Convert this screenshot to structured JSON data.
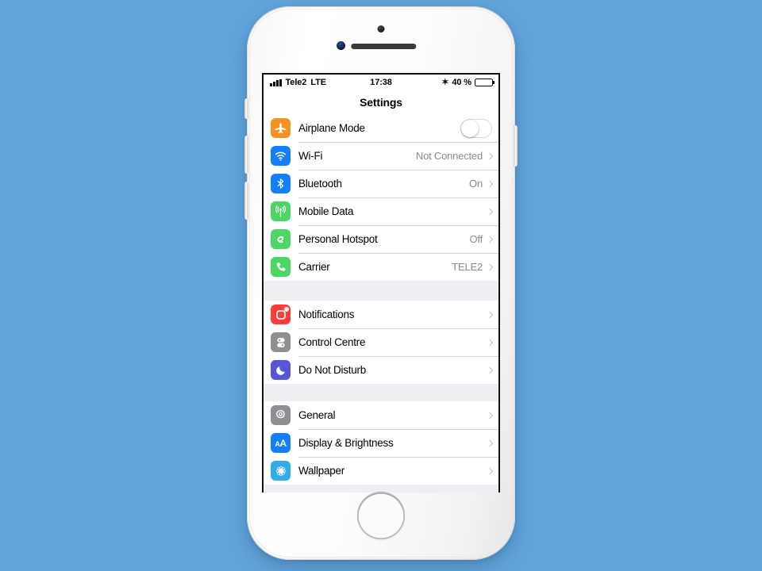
{
  "device": {
    "name": "iphone-white-silver",
    "background_color": "#62a5dc",
    "body_color": "#ffffff"
  },
  "status_bar": {
    "carrier": "Tele2",
    "network_type": "LTE",
    "time": "17:38",
    "bluetooth_icon": "✶",
    "battery_percent": "40 %",
    "battery_level": 40,
    "signal_bars": 4
  },
  "nav": {
    "title": "Settings"
  },
  "groups": [
    {
      "id": "connectivity",
      "rows": [
        {
          "icon": "airplane-icon",
          "icon_class": "ic-airplane",
          "label": "Airplane Mode",
          "value": "",
          "control": "switch",
          "switch_on": false,
          "color": "#f79121"
        },
        {
          "icon": "wifi-icon",
          "icon_class": "ic-wifi",
          "label": "Wi-Fi",
          "value": "Not Connected",
          "control": "chevron",
          "color": "#147efb"
        },
        {
          "icon": "bluetooth-icon",
          "icon_class": "ic-bluetooth",
          "label": "Bluetooth",
          "value": "On",
          "control": "chevron",
          "color": "#147efb"
        },
        {
          "icon": "mobile-data-icon",
          "icon_class": "ic-mobile",
          "label": "Mobile Data",
          "value": "",
          "control": "chevron",
          "color": "#4cd663"
        },
        {
          "icon": "hotspot-icon",
          "icon_class": "ic-hotspot",
          "label": "Personal Hotspot",
          "value": "Off",
          "control": "chevron",
          "color": "#4cd663"
        },
        {
          "icon": "carrier-icon",
          "icon_class": "ic-carrier",
          "label": "Carrier",
          "value": "TELE2",
          "control": "chevron",
          "color": "#4cd663"
        }
      ]
    },
    {
      "id": "alerts",
      "rows": [
        {
          "icon": "notifications-icon",
          "icon_class": "ic-notif",
          "label": "Notifications",
          "value": "",
          "control": "chevron",
          "color": "#fc3d39"
        },
        {
          "icon": "control-centre-icon",
          "icon_class": "ic-control",
          "label": "Control Centre",
          "value": "",
          "control": "chevron",
          "color": "#8e8e93"
        },
        {
          "icon": "do-not-disturb-icon",
          "icon_class": "ic-dnd",
          "label": "Do Not Disturb",
          "value": "",
          "control": "chevron",
          "color": "#5856d6"
        }
      ]
    },
    {
      "id": "system",
      "rows": [
        {
          "icon": "gear-icon",
          "icon_class": "ic-general",
          "label": "General",
          "value": "",
          "control": "chevron",
          "color": "#8e8e93"
        },
        {
          "icon": "display-icon",
          "icon_class": "ic-display",
          "label": "Display & Brightness",
          "value": "",
          "control": "chevron",
          "color": "#147efb"
        },
        {
          "icon": "wallpaper-icon",
          "icon_class": "ic-wallpaper",
          "label": "Wallpaper",
          "value": "",
          "control": "chevron",
          "color": "#31adea"
        }
      ]
    }
  ]
}
